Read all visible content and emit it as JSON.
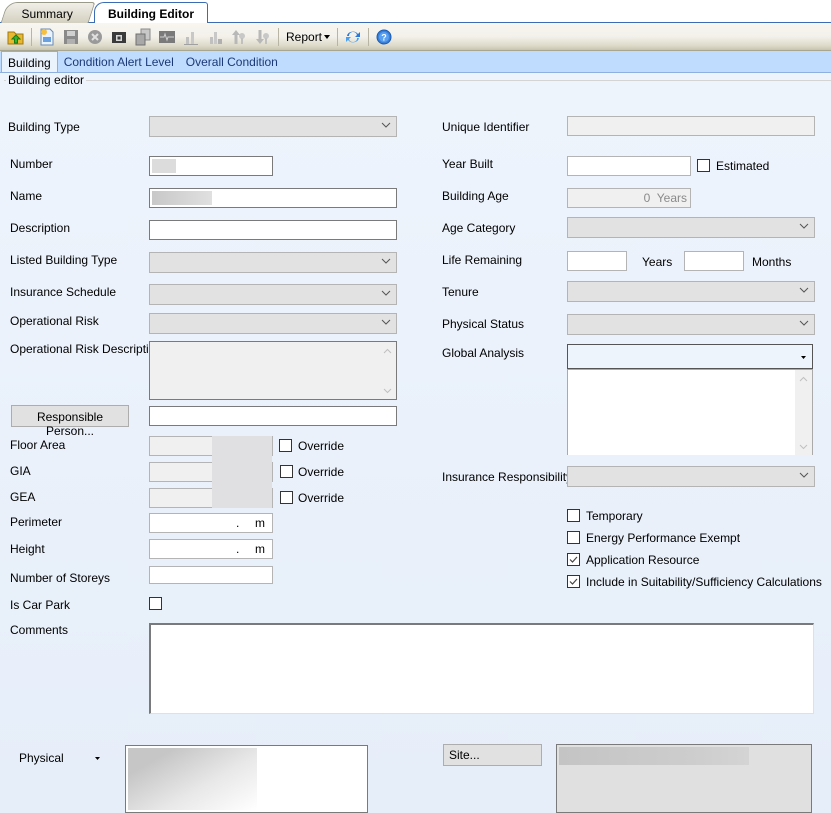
{
  "doc_tabs": {
    "summary": "Summary",
    "building_editor": "Building Editor"
  },
  "toolbar": {
    "icons": [
      "open-folder-icon",
      "new-document-icon",
      "save-icon",
      "delete-icon",
      "camera-icon",
      "copy-icon",
      "chart-line-icon",
      "bar-chart-icon",
      "bar-chart-export-icon",
      "move-up-icon",
      "move-down-icon"
    ],
    "report_label": "Report",
    "refresh_icon": "refresh-icon",
    "help_icon": "help-icon"
  },
  "section_tabs": [
    "Building",
    "Condition Alert Level",
    "Overall Condition"
  ],
  "group_title": "Building editor",
  "left": {
    "building_type_label": "Building Type",
    "number_label": "Number",
    "name_label": "Name",
    "description_label": "Description",
    "listed_building_type_label": "Listed Building Type",
    "insurance_schedule_label": "Insurance Schedule",
    "operational_risk_label": "Operational Risk",
    "operational_risk_description_label": "Operational Risk Description",
    "responsible_person_button": "Responsible Person...",
    "floor_area_label": "Floor Area",
    "gia_label": "GIA",
    "gea_label": "GEA",
    "override_label": "Override",
    "perimeter_label": "Perimeter",
    "perimeter_value": ".",
    "perimeter_unit": "m",
    "height_label": "Height",
    "height_value": ".",
    "height_unit": "m",
    "number_of_storeys_label": "Number of Storeys",
    "is_car_park_label": "Is Car Park",
    "comments_label": "Comments",
    "physical_label": "Physical"
  },
  "right": {
    "unique_identifier_label": "Unique Identifier",
    "year_built_label": "Year Built",
    "estimated_label": "Estimated",
    "building_age_label": "Building Age",
    "building_age_value": "0  Years",
    "age_category_label": "Age Category",
    "life_remaining_label": "Life Remaining",
    "years_label": "Years",
    "months_label": "Months",
    "tenure_label": "Tenure",
    "physical_status_label": "Physical Status",
    "global_analysis_label": "Global Analysis",
    "insurance_responsibility_label": "Insurance Responsibility",
    "checkboxes": [
      {
        "label": "Temporary",
        "checked": false
      },
      {
        "label": "Energy Performance Exempt",
        "checked": false
      },
      {
        "label": "Application Resource",
        "checked": true
      },
      {
        "label": "Include in Suitability/Sufficiency Calculations",
        "checked": true
      }
    ],
    "site_button": "Site..."
  }
}
